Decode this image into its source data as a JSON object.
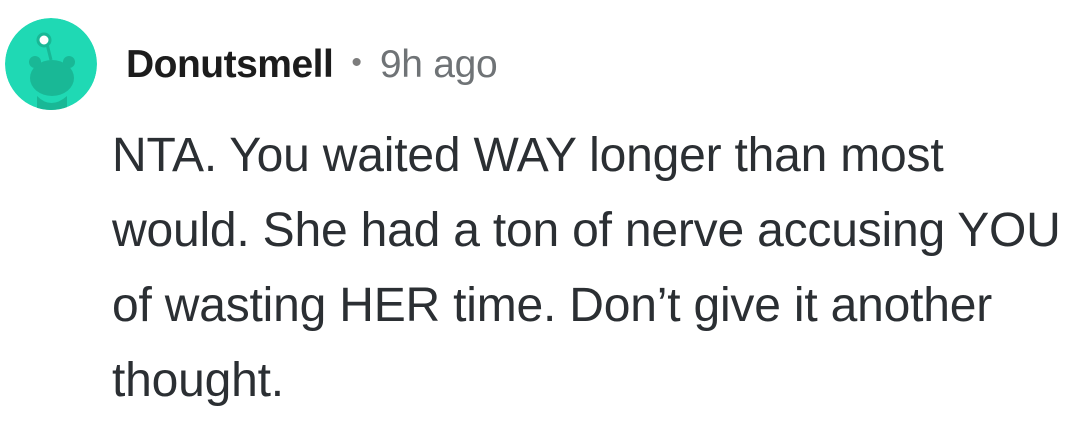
{
  "comment": {
    "avatar_icon": "reddit-snoo-avatar-icon",
    "avatar_color": "#1fd9b4",
    "username": "Donutsmell",
    "separator": "•",
    "timestamp": "9h ago",
    "text": "NTA. You waited WAY longer than most would. She had a ton of nerve accusing YOU of wasting HER time. Don’t give it another thought."
  }
}
